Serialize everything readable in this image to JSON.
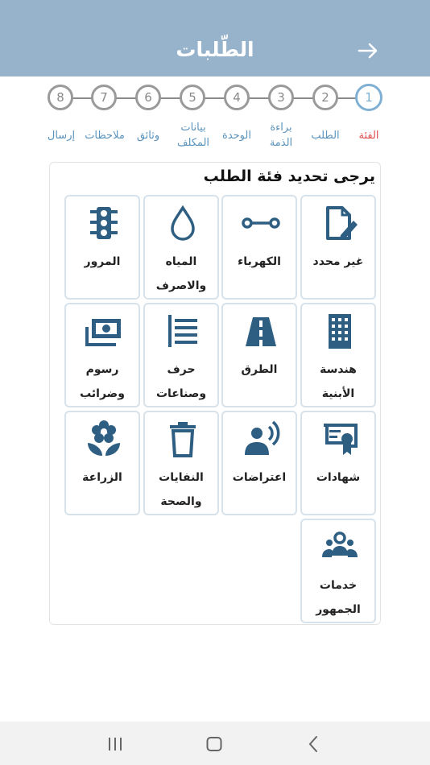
{
  "header": {
    "title": "الطّلبات",
    "back_icon": "arrow-right-icon",
    "bg_color": "#96b3cb"
  },
  "stepper": {
    "active_color": "#7fb0d4",
    "steps": [
      {
        "number": "1",
        "label": "الفئة",
        "active": true
      },
      {
        "number": "2",
        "label": "الطلب"
      },
      {
        "number": "3",
        "label": "براءة الذمة"
      },
      {
        "number": "4",
        "label": "الوحدة"
      },
      {
        "number": "5",
        "label": "بيانات المكلف"
      },
      {
        "number": "6",
        "label": "وثائق"
      },
      {
        "number": "7",
        "label": "ملاحظات"
      },
      {
        "number": "8",
        "label": "إرسال"
      }
    ]
  },
  "main": {
    "title": "يرجى تحديد فئة الطلب",
    "icon_color": "#2e5f82",
    "categories": [
      {
        "label": "غير محدد",
        "icon": "edit-document-icon"
      },
      {
        "label": "الكهرباء",
        "icon": "power-line-icon"
      },
      {
        "label": "المياه والاصرف",
        "icon": "water-drop-icon"
      },
      {
        "label": "المرور",
        "icon": "traffic-light-icon"
      },
      {
        "label": "هندسة الأبنية",
        "icon": "building-icon"
      },
      {
        "label": "الطرق",
        "icon": "road-icon"
      },
      {
        "label": "حرف وصناعات",
        "icon": "list-icon"
      },
      {
        "label": "رسوم وضرائب",
        "icon": "money-icon"
      },
      {
        "label": "شهادات",
        "icon": "certificate-icon"
      },
      {
        "label": "اعتراضات",
        "icon": "speaker-person-icon"
      },
      {
        "label": "النفايات والصحة",
        "icon": "trash-icon"
      },
      {
        "label": "الزراعة",
        "icon": "flower-icon"
      },
      {
        "label": "خدمات الجمهور",
        "icon": "people-group-icon"
      }
    ]
  },
  "system_nav": {
    "recents_icon": "recents-icon",
    "home_icon": "home-icon",
    "back_icon": "back-chevron-icon"
  }
}
